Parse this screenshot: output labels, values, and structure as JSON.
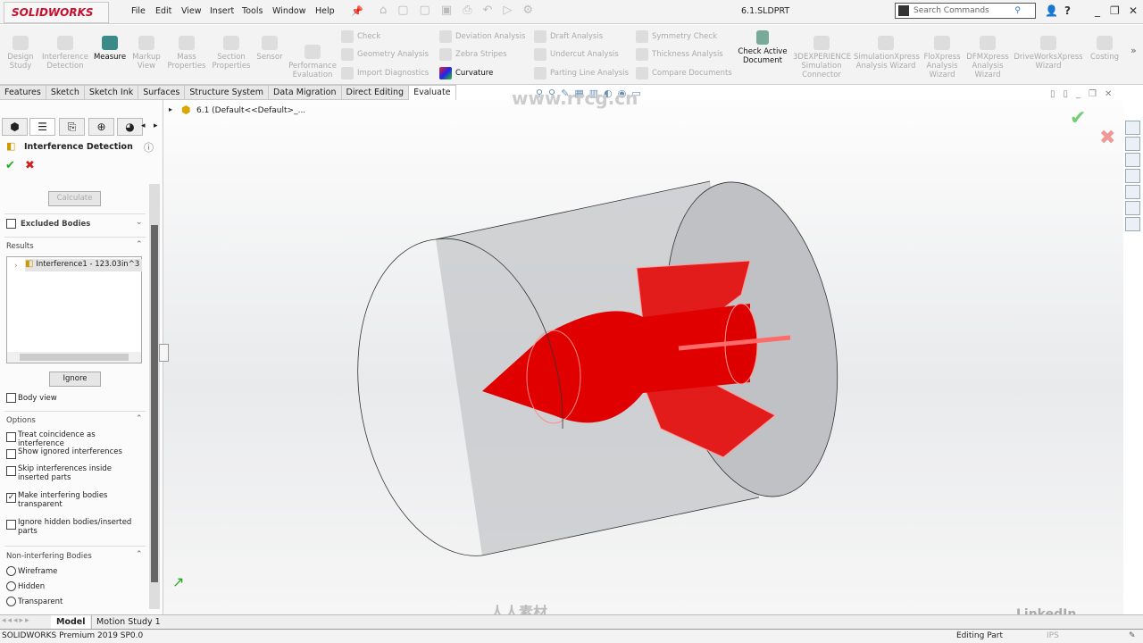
{
  "app": {
    "logo": "SOLIDWORKS",
    "document_title": "6.1.SLDPRT"
  },
  "menu": [
    "File",
    "Edit",
    "View",
    "Insert",
    "Tools",
    "Window",
    "Help"
  ],
  "search": {
    "placeholder": "Search Commands"
  },
  "ribbon": {
    "large": [
      {
        "label": "Design Study",
        "enabled": false
      },
      {
        "label": "Interference Detection",
        "enabled": false
      },
      {
        "label": "Measure",
        "enabled": true
      },
      {
        "label": "Markup View",
        "enabled": false
      },
      {
        "label": "Mass Properties",
        "enabled": false
      },
      {
        "label": "Section Properties",
        "enabled": false
      },
      {
        "label": "Sensor",
        "enabled": false
      },
      {
        "label": "Performance Evaluation",
        "enabled": false
      }
    ],
    "small": [
      {
        "label": "Check",
        "enabled": false
      },
      {
        "label": "Geometry Analysis",
        "enabled": false
      },
      {
        "label": "Import Diagnostics",
        "enabled": false
      },
      {
        "label": "Deviation Analysis",
        "enabled": false
      },
      {
        "label": "Zebra Stripes",
        "enabled": false
      },
      {
        "label": "Curvature",
        "enabled": true
      },
      {
        "label": "Draft Analysis",
        "enabled": false
      },
      {
        "label": "Undercut Analysis",
        "enabled": false
      },
      {
        "label": "Parting Line Analysis",
        "enabled": false
      },
      {
        "label": "Symmetry Check",
        "enabled": false
      },
      {
        "label": "Thickness Analysis",
        "enabled": false
      },
      {
        "label": "Compare Documents",
        "enabled": false
      }
    ],
    "check_active": "Check Active Document",
    "right": [
      "3DEXPERIENCE Simulation Connector",
      "SimulationXpress Analysis Wizard",
      "FloXpress Analysis Wizard",
      "DFMXpress Analysis Wizard",
      "DriveWorksXpress Wizard",
      "Costing"
    ]
  },
  "tabs": [
    {
      "label": "Features"
    },
    {
      "label": "Sketch"
    },
    {
      "label": "Sketch Ink"
    },
    {
      "label": "Surfaces"
    },
    {
      "label": "Structure System"
    },
    {
      "label": "Data Migration"
    },
    {
      "label": "Direct Editing"
    },
    {
      "label": "Evaluate",
      "active": true
    }
  ],
  "tree": {
    "root": "6.1  (Default<<Default>_..."
  },
  "panel": {
    "title": "Interference Detection",
    "calculate": "Calculate",
    "excluded_bodies": "Excluded Bodies",
    "results_header": "Results",
    "result_item": "Interference1 - 123.03in^3",
    "ignore": "Ignore",
    "body_view": "Body view",
    "options_header": "Options",
    "options": [
      {
        "label": "Treat coincidence as interference",
        "checked": false
      },
      {
        "label": "Show ignored interferences",
        "checked": false
      },
      {
        "label": "Skip interferences inside inserted parts",
        "checked": false
      },
      {
        "label": "Make interfering bodies transparent",
        "checked": true
      },
      {
        "label": "Ignore hidden bodies/inserted parts",
        "checked": false
      }
    ],
    "noninterfering_header": "Non-interfering Bodies",
    "noninterfering": [
      {
        "label": "Wireframe"
      },
      {
        "label": "Hidden"
      },
      {
        "label": "Transparent"
      }
    ]
  },
  "bottom_tabs": [
    "Model",
    "Motion Study 1"
  ],
  "status": {
    "version": "SOLIDWORKS Premium 2019 SP0.0",
    "mode": "Editing Part",
    "units": "IPS"
  },
  "watermarks": {
    "linkedin": "LinkedIn LEARNING",
    "site": "www.rrcg.cn",
    "brand": "人人素材"
  },
  "colors": {
    "interference": "#e00000",
    "logo": "#c8102e"
  }
}
